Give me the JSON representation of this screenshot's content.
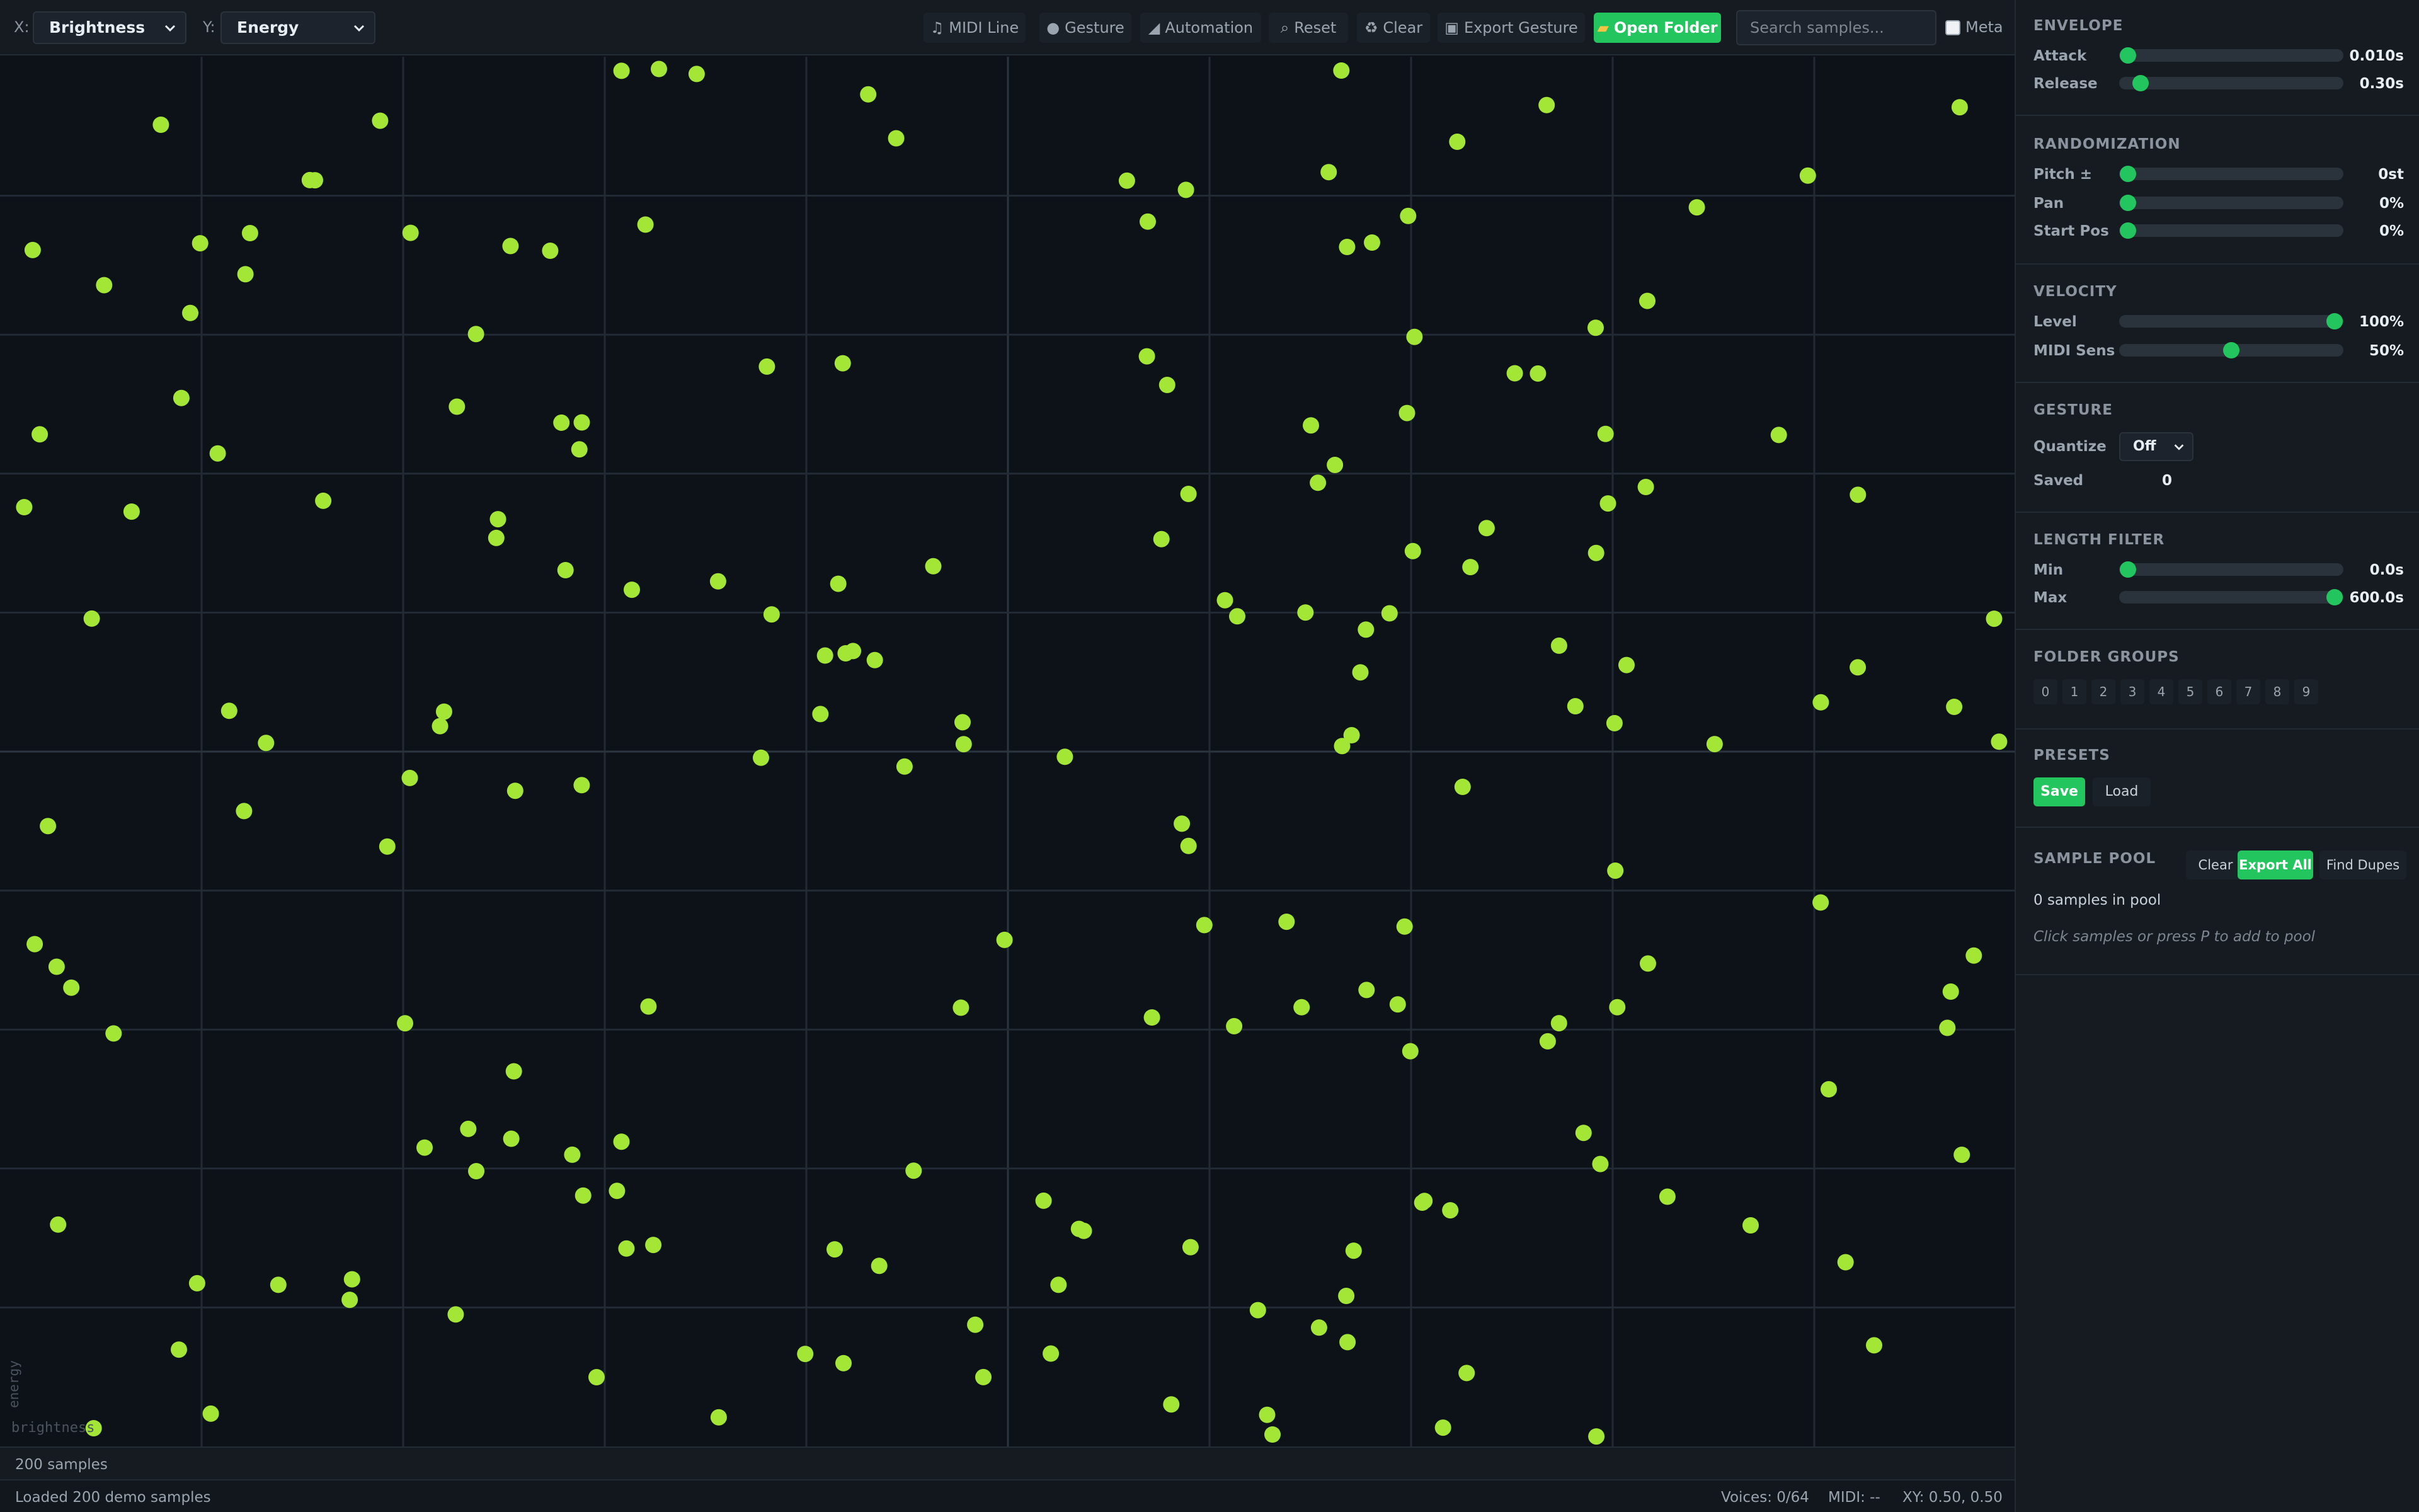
{
  "toolbar": {
    "x_label": "X:",
    "x_value": "Brightness",
    "y_label": "Y:",
    "y_value": "Energy",
    "buttons": {
      "midi_line": "MIDI Line",
      "gesture": "Gesture",
      "automation": "Automation",
      "reset": "Reset",
      "clear": "Clear",
      "export_gesture": "Export Gesture",
      "open_folder": "Open Folder"
    },
    "search_placeholder": "Search samples...",
    "meta_label": "Meta"
  },
  "plot": {
    "x_axis_label": "brightness",
    "y_axis_label": "energy",
    "point_color": "#a3e635",
    "grid_color": "#222b35"
  },
  "status": {
    "count": "200 samples",
    "message": "Loaded 200 demo samples",
    "voices": "Voices: 0/64",
    "midi": "MIDI: --",
    "xy": "XY: 0.50, 0.50"
  },
  "panel": {
    "envelope": {
      "title": "ENVELOPE",
      "attack": {
        "label": "Attack",
        "value": "0.010s",
        "level": 0.0
      },
      "release": {
        "label": "Release",
        "value": "0.30s",
        "level": 0.06
      }
    },
    "randomization": {
      "title": "RANDOMIZATION",
      "pitch": {
        "label": "Pitch ±",
        "value": "0st",
        "level": 0.0
      },
      "pan": {
        "label": "Pan",
        "value": "0%",
        "level": 0.0
      },
      "start_pos": {
        "label": "Start Pos",
        "value": "0%",
        "level": 0.0
      }
    },
    "velocity": {
      "title": "VELOCITY",
      "level": {
        "label": "Level",
        "value": "100%",
        "level": 1.0
      },
      "midi_sens": {
        "label": "MIDI Sens",
        "value": "50%",
        "level": 0.5
      }
    },
    "gesture": {
      "title": "GESTURE",
      "quantize_label": "Quantize",
      "quantize_value": "Off",
      "saved_label": "Saved",
      "saved_value": "0"
    },
    "length_filter": {
      "title": "LENGTH FILTER",
      "min": {
        "label": "Min",
        "value": "0.0s",
        "level": 0.0
      },
      "max": {
        "label": "Max",
        "value": "600.0s",
        "level": 1.0
      }
    },
    "folder_groups": {
      "title": "FOLDER GROUPS",
      "items": [
        "0",
        "1",
        "2",
        "3",
        "4",
        "5",
        "6",
        "7",
        "8",
        "9"
      ]
    },
    "presets": {
      "title": "PRESETS",
      "save": "Save",
      "load": "Load"
    },
    "sample_pool": {
      "title": "SAMPLE POOL",
      "clear": "Clear",
      "export_all": "Export All",
      "find_dupes": "Find Dupes",
      "count": "0 samples in pool",
      "hint": "Click samples or press P to add to pool"
    }
  },
  "colors": {
    "accent": "#22c55e",
    "point": "#a3e635",
    "background": "#0d1118"
  }
}
